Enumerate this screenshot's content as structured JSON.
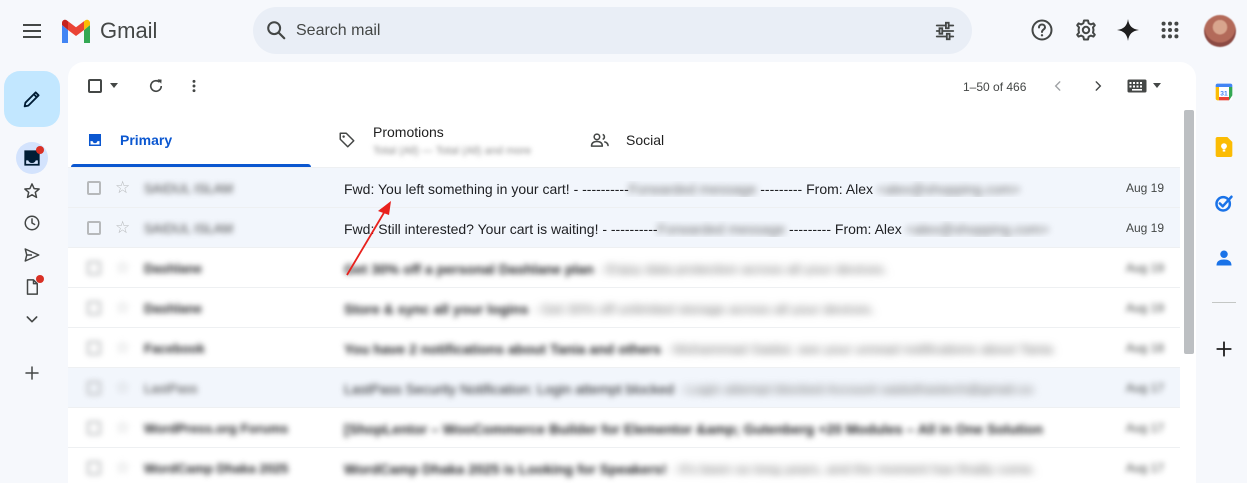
{
  "app": {
    "name": "Gmail"
  },
  "search": {
    "placeholder": "Search mail"
  },
  "toolbar": {
    "range": "1–50 of 466"
  },
  "tabs": [
    {
      "label": "Primary",
      "active": true
    },
    {
      "label": "Promotions",
      "subtitle": "Total (All) — Total (All) and more"
    },
    {
      "label": "Social"
    }
  ],
  "emails": [
    {
      "sender": "SAIDUL ISLAM",
      "subject": "Fwd: You left something in your cart! - ----------",
      "snippet_blur": "Forwarded message",
      "mid": " --------- From: Alex ",
      "tail_blur": "<alex@shopping.com>",
      "date": "Aug 19"
    },
    {
      "sender": "SAIDUL ISLAM",
      "subject": "Fwd: Still interested? Your cart is waiting! - ----------",
      "snippet_blur": "Forwarded message",
      "mid": " --------- From: Alex ",
      "tail_blur": "<alex@shopping.com>",
      "date": "Aug 19"
    },
    {
      "sender": "Dashlane",
      "subject": "Get 30% off a personal Dashlane plan",
      "snippet_blur": " - Enjoy data protection across all your devices.",
      "date": "Aug 19"
    },
    {
      "sender": "Dashlane",
      "subject": "Store & sync all your logins",
      "snippet_blur": " - Get 30% off unlimited storage across all your devices.",
      "date": "Aug 19"
    },
    {
      "sender": "Facebook",
      "subject": "You have 2 notifications about Tania and others",
      "snippet_blur": " - Mohammad Saidul, see your unread notifications about Tania",
      "date": "Aug 18"
    },
    {
      "sender": "LastPass",
      "subject": "LastPass Security Notification: Login attempt blocked",
      "snippet_blur": " - Login attempt blocked Account saidulhastech@gmail.co",
      "date": "Aug 17"
    },
    {
      "sender": "WordPress.org Forums",
      "subject": "[ShopLentor – WooCommerce Builder for Elementor &amp; Gutenberg +20 Modules – All in One Solution",
      "snippet_blur": "",
      "date": "Aug 17"
    },
    {
      "sender": "WordCamp Dhaka 2025",
      "subject": "WordCamp Dhaka 2025 is Looking for Speakers!",
      "snippet_blur": " - It's been so long years, and the moment has finally come.",
      "date": "Aug 17"
    }
  ],
  "colors": {
    "accent": "#0b57d0",
    "compose_bg": "#c2e7ff",
    "badge": "#d93025",
    "annotation": "#e8211d"
  }
}
